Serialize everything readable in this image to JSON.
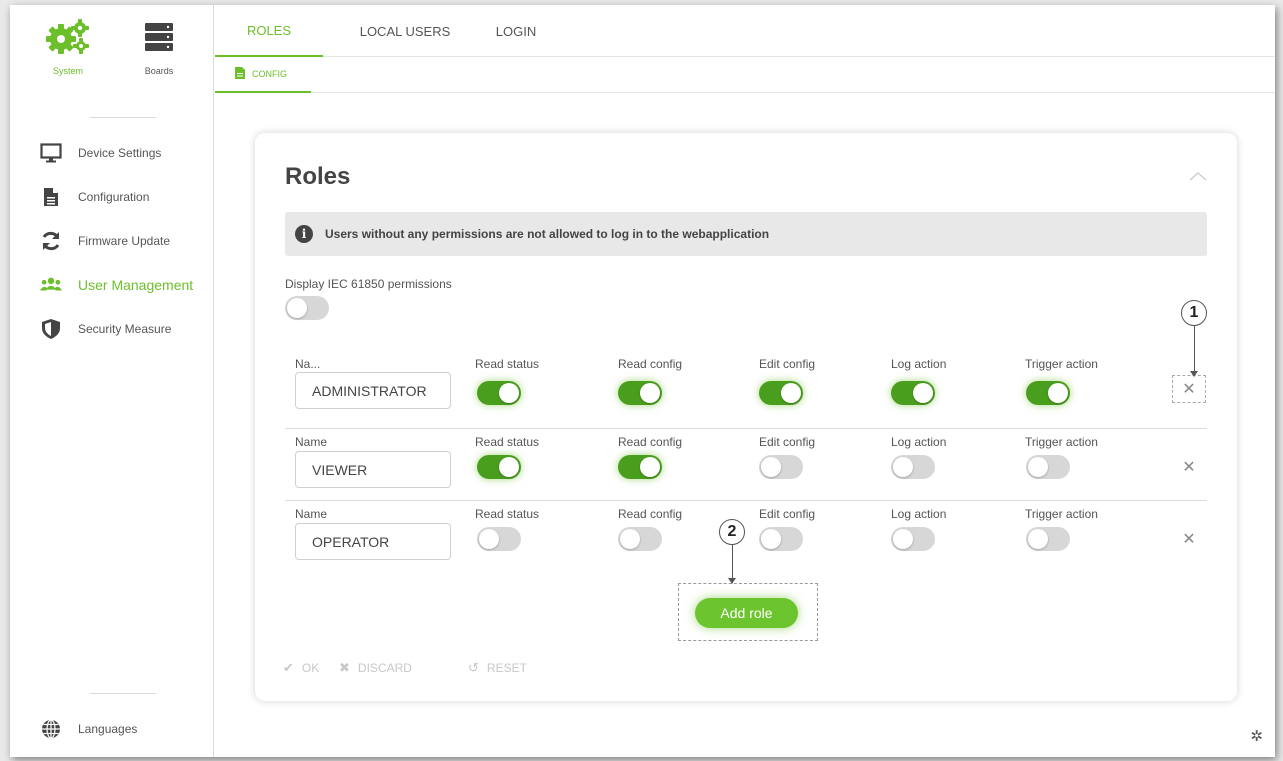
{
  "sidebar": {
    "top": [
      {
        "label": "System",
        "icon": "gears-icon"
      },
      {
        "label": "Boards",
        "icon": "boards-icon"
      }
    ],
    "items": [
      {
        "label": "Device Settings",
        "icon": "monitor-icon"
      },
      {
        "label": "Configuration",
        "icon": "document-icon"
      },
      {
        "label": "Firmware Update",
        "icon": "refresh-icon"
      },
      {
        "label": "User Management",
        "icon": "users-icon",
        "active": true
      },
      {
        "label": "Security Measure",
        "icon": "shield-icon"
      }
    ],
    "bottom": {
      "label": "Languages",
      "icon": "globe-icon"
    }
  },
  "tabs": [
    {
      "label": "ROLES",
      "active": true
    },
    {
      "label": "LOCAL USERS"
    },
    {
      "label": "LOGIN"
    }
  ],
  "subtab": {
    "label": "CONFIG",
    "icon": "file-icon"
  },
  "card": {
    "title": "Roles",
    "info": "Users without any permissions are not allowed to log in to the webapplication",
    "iec_label": "Display IEC 61850 permissions",
    "iec_enabled": false
  },
  "columns": [
    "Read status",
    "Read config",
    "Edit config",
    "Log action",
    "Trigger action"
  ],
  "roles": [
    {
      "name_label": "Na...",
      "name": "ADMINISTRATOR",
      "perms": [
        true,
        true,
        true,
        true,
        true
      ]
    },
    {
      "name_label": "Name",
      "name": "VIEWER",
      "perms": [
        true,
        true,
        false,
        false,
        false
      ]
    },
    {
      "name_label": "Name",
      "name": "OPERATOR",
      "perms": [
        false,
        false,
        false,
        false,
        false
      ]
    }
  ],
  "add_role_label": "Add role",
  "actions": {
    "ok": "OK",
    "discard": "DISCARD",
    "reset": "RESET"
  },
  "callouts": [
    "1",
    "2"
  ],
  "colors": {
    "accent": "#6cbf2a",
    "toggle_on": "#4a9e1e",
    "toggle_off": "#d7d7d7"
  }
}
